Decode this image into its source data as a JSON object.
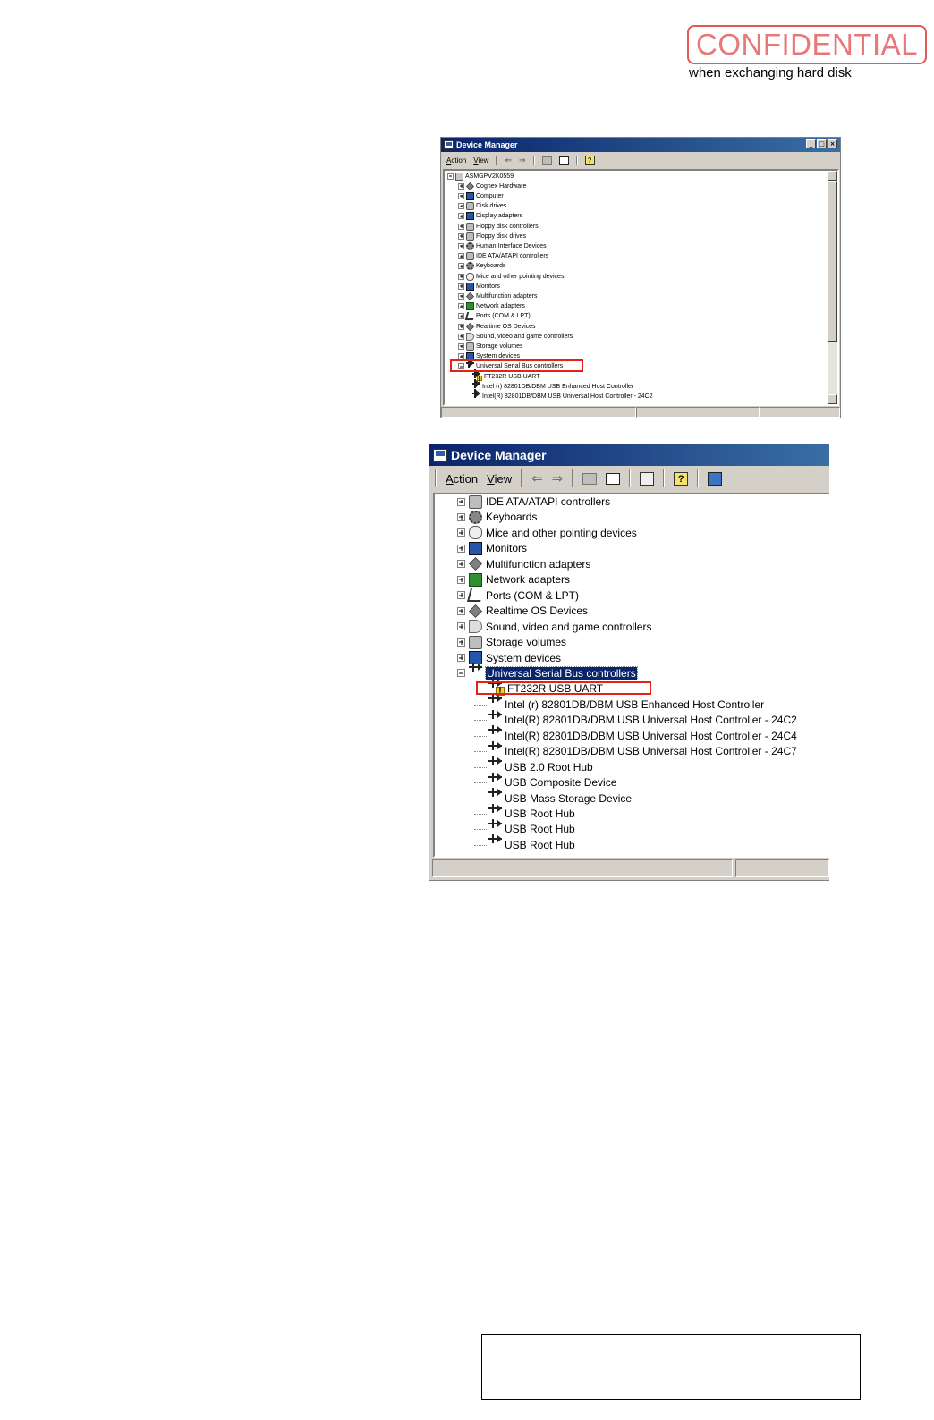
{
  "stamp": {
    "label": "CONFIDENTIAL",
    "note": "when exchanging hard disk",
    "color": "#e87878"
  },
  "small_window": {
    "title": "Device Manager",
    "menu": [
      "Action",
      "View"
    ],
    "root": "ASMGPV2K0559",
    "highlighted_item": "Universal Serial Bus controllers",
    "categories": [
      "Cognex Hardware",
      "Computer",
      "Disk drives",
      "Display adapters",
      "Floppy disk controllers",
      "Floppy disk drives",
      "Human Interface Devices",
      "IDE ATA/ATAPI controllers",
      "Keyboards",
      "Mice and other pointing devices",
      "Monitors",
      "Multifunction adapters",
      "Network adapters",
      "Ports (COM & LPT)",
      "Realtime OS Devices",
      "Sound, video and game controllers",
      "Storage volumes",
      "System devices",
      "Universal Serial Bus controllers"
    ],
    "usb_children": [
      "FT232R USB UART",
      "Intel (r) 82801DB/DBM USB Enhanced Host Controller",
      "Intel(R) 82801DB/DBM USB Universal Host Controller - 24C2"
    ]
  },
  "large_window": {
    "title": "Device Manager",
    "menu": [
      "Action",
      "View"
    ],
    "categories": [
      "IDE ATA/ATAPI controllers",
      "Keyboards",
      "Mice and other pointing devices",
      "Monitors",
      "Multifunction adapters",
      "Network adapters",
      "Ports (COM & LPT)",
      "Realtime OS Devices",
      "Sound, video and game controllers",
      "Storage volumes",
      "System devices",
      "Universal Serial Bus controllers"
    ],
    "selected_item": "Universal Serial Bus controllers",
    "highlighted_item": "FT232R USB UART",
    "usb_children": [
      "FT232R USB UART",
      "Intel (r) 82801DB/DBM USB Enhanced Host Controller",
      "Intel(R) 82801DB/DBM USB Universal Host Controller - 24C2",
      "Intel(R) 82801DB/DBM USB Universal Host Controller - 24C4",
      "Intel(R) 82801DB/DBM USB Universal Host Controller - 24C7",
      "USB 2.0 Root Hub",
      "USB Composite Device",
      "USB Mass Storage Device",
      "USB Root Hub",
      "USB Root Hub",
      "USB Root Hub"
    ],
    "icons": {
      "IDE ATA/ATAPI controllers": "ide-icon",
      "Keyboards": "keyboard-icon",
      "Mice and other pointing devices": "mouse-icon",
      "Monitors": "monitor-icon",
      "Multifunction adapters": "multifunction-icon",
      "Network adapters": "network-adapter-icon",
      "Ports (COM & LPT)": "port-icon",
      "Realtime OS Devices": "realtime-os-icon",
      "Sound, video and game controllers": "sound-icon",
      "Storage volumes": "storage-icon",
      "System devices": "system-device-icon",
      "Universal Serial Bus controllers": "usb-icon"
    }
  },
  "highlight_color": "#e2231a"
}
